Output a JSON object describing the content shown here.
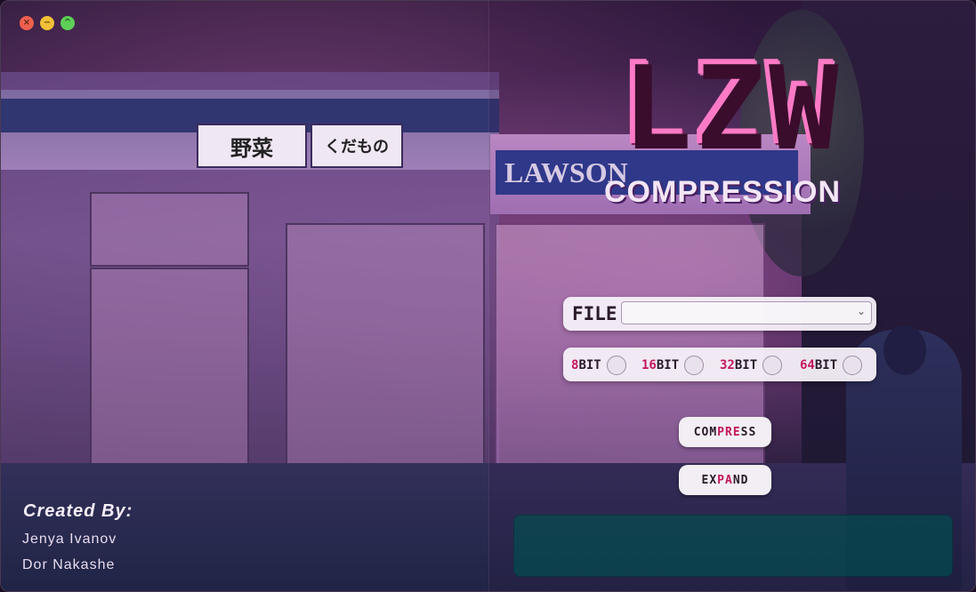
{
  "window": {
    "controls": [
      "close",
      "minimize",
      "maximize"
    ],
    "control_glyphs": {
      "close": "×",
      "minimize": "−",
      "maximize": "^"
    }
  },
  "header": {
    "logo_text": "LZW",
    "subtitle": "COMPRESSION"
  },
  "background": {
    "sign_vegetables": "野菜",
    "sign_fruits": "くだもの",
    "store_name": "LAWSON"
  },
  "file": {
    "label": "FILE",
    "selected_value": ""
  },
  "bit_options": [
    {
      "num": "8",
      "suffix": "BIT",
      "selected": false
    },
    {
      "num": "16",
      "suffix": "BIT",
      "selected": false
    },
    {
      "num": "32",
      "suffix": "BIT",
      "selected": false
    },
    {
      "num": "64",
      "suffix": "BIT",
      "selected": false
    }
  ],
  "buttons": {
    "compress": {
      "pre": "COM",
      "hi": "PRE",
      "post": "SS"
    },
    "expand": {
      "pre": "EX",
      "hi": "PA",
      "post": "ND"
    }
  },
  "output": {
    "text": ""
  },
  "credits": {
    "title": "Created By:",
    "authors": [
      "Jenya Ivanov",
      "Dor Nakashe"
    ]
  },
  "colors": {
    "accent": "#c2185b",
    "panel": "#f2eef4",
    "output_bg": "#005050"
  }
}
